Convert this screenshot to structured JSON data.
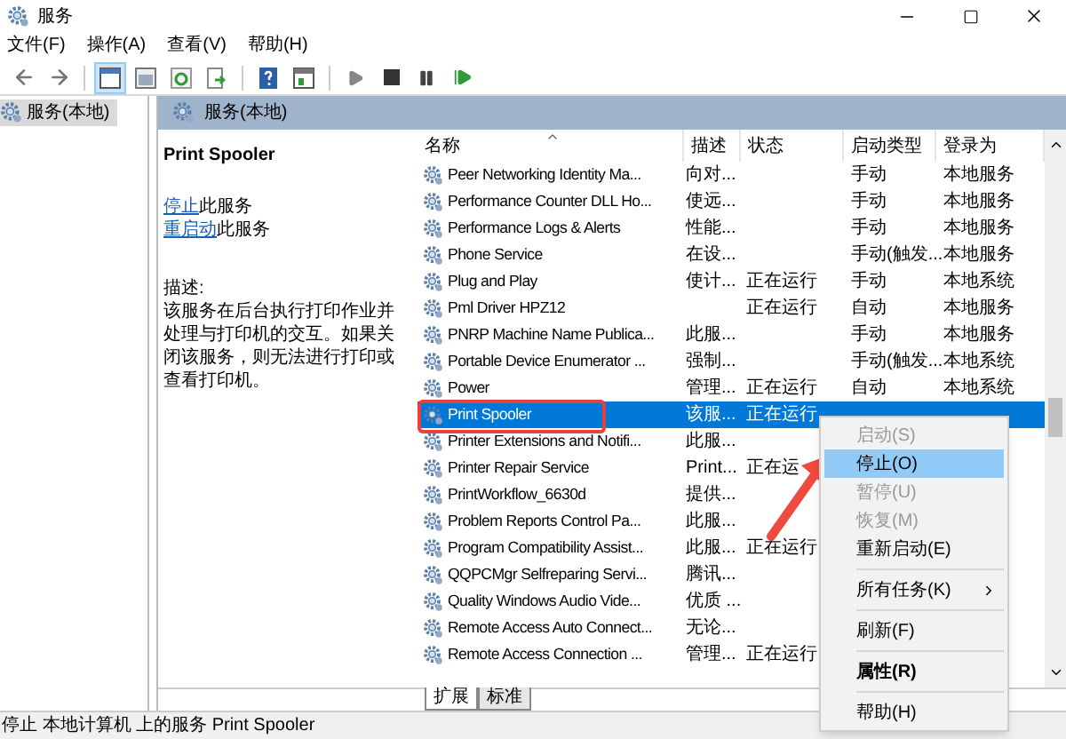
{
  "window": {
    "title": "服务"
  },
  "menu": [
    "文件(F)",
    "操作(A)",
    "查看(V)",
    "帮助(H)"
  ],
  "tree": [
    {
      "label": "服务(本地)",
      "selected": true
    }
  ],
  "panel_header": "服务(本地)",
  "details": {
    "title": "Print Spooler",
    "actions": [
      {
        "link": "停止",
        "text": "此服务"
      },
      {
        "link": "重启动",
        "text": "此服务"
      }
    ],
    "description_label": "描述:",
    "description": "该服务在后台执行打印作业并处理与打印机的交互。如果关闭该服务，则无法进行打印或查看打印机。"
  },
  "table": {
    "columns": [
      "名称",
      "描述",
      "状态",
      "启动类型",
      "登录为"
    ],
    "rows": [
      {
        "name": "Peer Networking Identity Ma...",
        "desc": "向对...",
        "startup": "手动",
        "logon": "本地服务",
        "selected": false
      },
      {
        "name": "Performance Counter DLL Ho...",
        "desc": "使远...",
        "startup": "手动",
        "logon": "本地服务",
        "selected": false
      },
      {
        "name": "Performance Logs & Alerts",
        "desc": "性能...",
        "startup": "手动",
        "logon": "本地服务",
        "selected": false
      },
      {
        "name": "Phone Service",
        "desc": "在设...",
        "startup": "手动(触发...",
        "logon": "本地服务",
        "selected": false
      },
      {
        "name": "Plug and Play",
        "desc": "使计...",
        "status": "正在运行",
        "startup": "手动",
        "logon": "本地系统",
        "selected": false
      },
      {
        "name": "Pml Driver HPZ12",
        "status": "正在运行",
        "startup": "自动",
        "logon": "本地服务",
        "selected": false
      },
      {
        "name": "PNRP Machine Name Publica...",
        "desc": "此服...",
        "startup": "手动",
        "logon": "本地服务",
        "selected": false
      },
      {
        "name": "Portable Device Enumerator ...",
        "desc": "强制...",
        "startup": "手动(触发...",
        "logon": "本地系统",
        "selected": false
      },
      {
        "name": "Power",
        "desc": "管理...",
        "status": "正在运行",
        "startup": "自动",
        "logon": "本地系统",
        "selected": false
      },
      {
        "name": "Print Spooler",
        "desc": "该服...",
        "status": "正在运行",
        "selected": true
      },
      {
        "name": "Printer Extensions and Notifi...",
        "desc": "此服...",
        "selected": false
      },
      {
        "name": "Printer Repair Service",
        "desc": "Print...",
        "status": "正在运",
        "selected": false
      },
      {
        "name": "PrintWorkflow_6630d",
        "desc": "提供...",
        "selected": false
      },
      {
        "name": "Problem Reports Control Pa...",
        "desc": "此服...",
        "selected": false
      },
      {
        "name": "Program Compatibility Assist...",
        "desc": "此服...",
        "status": "正在运行",
        "selected": false
      },
      {
        "name": "QQPCMgr Selfreparing Servi...",
        "desc": "腾讯...",
        "selected": false
      },
      {
        "name": "Quality Windows Audio Vide...",
        "desc": "优质 ...",
        "selected": false
      },
      {
        "name": "Remote Access Auto Connect...",
        "desc": "无论...",
        "selected": false
      },
      {
        "name": "Remote Access Connection ...",
        "desc": "管理...",
        "status": "正在运行",
        "selected": false
      }
    ]
  },
  "context_menu": [
    {
      "kind": "item",
      "label": "启动(S)",
      "disabled": true,
      "selected": false
    },
    {
      "kind": "item",
      "label": "停止(O)",
      "disabled": false,
      "selected": true
    },
    {
      "kind": "item",
      "label": "暂停(U)",
      "disabled": true,
      "selected": false
    },
    {
      "kind": "item",
      "label": "恢复(M)",
      "disabled": true,
      "selected": false
    },
    {
      "kind": "item",
      "label": "重新启动(E)",
      "disabled": false,
      "selected": false
    },
    {
      "kind": "separator"
    },
    {
      "kind": "submenu",
      "label": "所有任务(K)",
      "disabled": false,
      "selected": false
    },
    {
      "kind": "separator"
    },
    {
      "kind": "item",
      "label": "刷新(F)",
      "disabled": false,
      "selected": false
    },
    {
      "kind": "separator"
    },
    {
      "kind": "default",
      "label": "属性(R)",
      "disabled": false,
      "selected": false
    },
    {
      "kind": "separator"
    },
    {
      "kind": "item",
      "label": "帮助(H)",
      "disabled": false,
      "selected": false
    }
  ],
  "tabs": [
    {
      "label": "扩展",
      "selected": true
    },
    {
      "label": "标准",
      "selected": false
    }
  ],
  "status_bar": "停止 本地计算机 上的服务 Print Spooler"
}
